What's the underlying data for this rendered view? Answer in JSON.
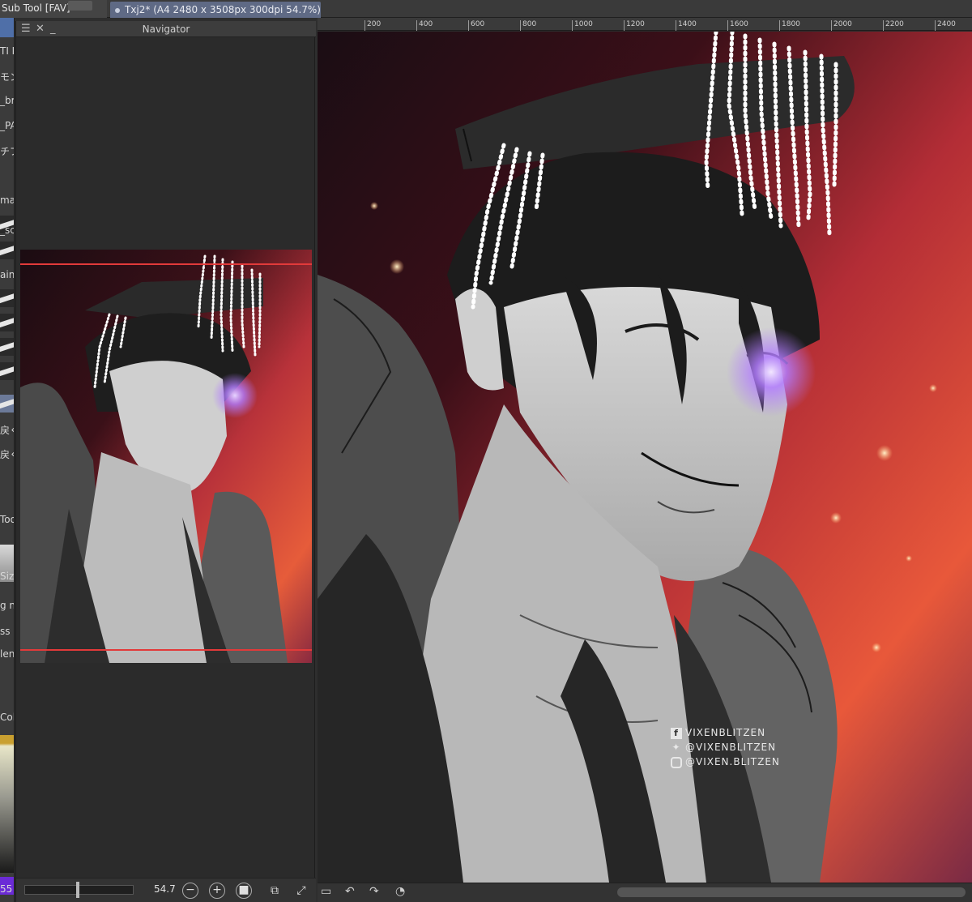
{
  "titlebar": {
    "subtool_panel_title": "Sub Tool [FAV]",
    "document_tab": "Txj2* (A4 2480 x 3508px 300dpi 54.7%)"
  },
  "left_strip": {
    "labels": [
      "TI P",
      "モン",
      "_bru",
      "_PA",
      "チプ",
      "mar",
      "_sc",
      "aint",
      "戻く",
      "戻く",
      "Too",
      "Size",
      "g n",
      "ss",
      "len",
      "Col",
      "55"
    ]
  },
  "navigator": {
    "title": "Navigator",
    "zoom_value": "54.7",
    "zoom_fraction": 0.49
  },
  "ruler": {
    "ticks": [
      "200",
      "400",
      "600",
      "800",
      "1000",
      "1200",
      "1400",
      "1600",
      "1800",
      "2000",
      "2200",
      "2400"
    ]
  },
  "artwork": {
    "watermark": {
      "facebook": "VIXENBLITZEN",
      "twitter": "@VIXENBLITZEN",
      "instagram": "@VIXEN.BLITZEN"
    }
  },
  "icons": {
    "menu": "menu-icon",
    "close": "close-icon",
    "minimize": "minimize-icon",
    "zoom_out": "zoom-out-icon",
    "zoom_in": "zoom-in-icon",
    "fit": "fit-icon",
    "rotate_left": "rotate-left-icon",
    "rotate_right": "rotate-right-icon",
    "reset_rotation": "reset-rotation-icon"
  },
  "colors": {
    "tab_active": "#5f6a85",
    "accent_glow": "#b27cff",
    "background_red": "#e0483c",
    "background_dark": "#1a0d14"
  }
}
